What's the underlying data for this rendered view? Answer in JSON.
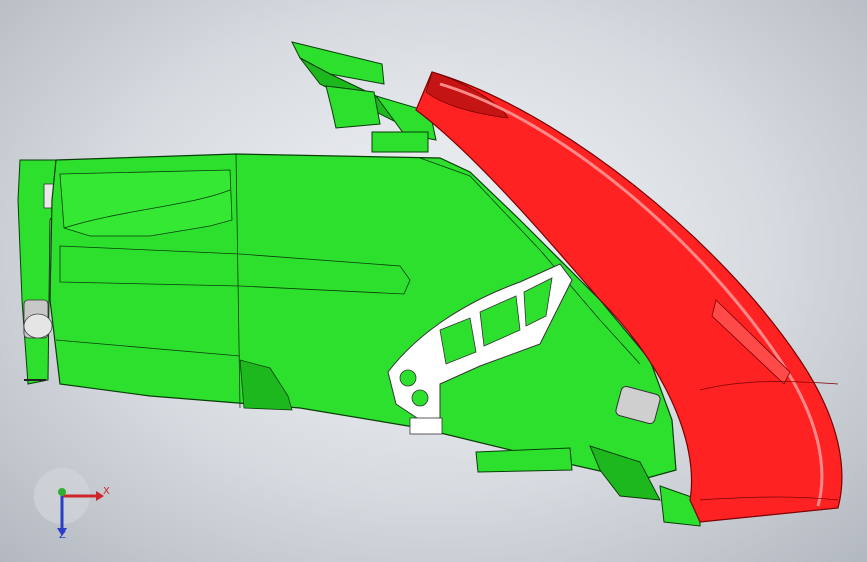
{
  "colors": {
    "background_center": "#f2f4f6",
    "background_edge": "#b3b8c0",
    "body_green": "#2ee02e",
    "body_green_dark": "#1db81d",
    "edge_line": "#0a3d0a",
    "lens_red": "#ff2222",
    "lens_red_dark": "#c41414",
    "rib_white": "#ffffff",
    "chrome": "#c8c8c8",
    "axis_x": "#d0252a",
    "axis_y": "#2fae2f",
    "axis_z": "#2a3ec8"
  },
  "triad": {
    "x_label": "X",
    "z_label": "Z"
  }
}
